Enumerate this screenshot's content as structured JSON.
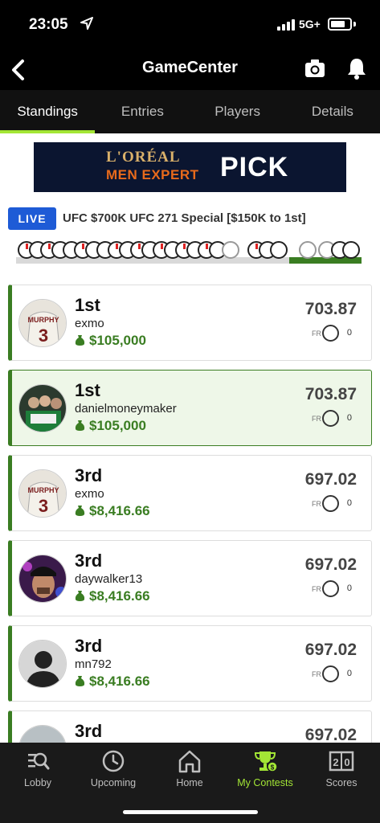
{
  "status_bar": {
    "time": "23:05",
    "network": "5G+"
  },
  "header": {
    "title": "GameCenter",
    "icons": [
      "back-icon",
      "camera-icon",
      "bell-icon"
    ]
  },
  "tabs": [
    {
      "label": "Standings",
      "active": true
    },
    {
      "label": "Entries",
      "active": false
    },
    {
      "label": "Players",
      "active": false
    },
    {
      "label": "Details",
      "active": false
    }
  ],
  "ad": {
    "brand_line1": "L'ORÉAL",
    "brand_line2": "MEN EXPERT",
    "cta": "PICK"
  },
  "contest": {
    "live_label": "LIVE",
    "title": "UFC $700K UFC 271 Special [$150K to 1st]"
  },
  "entries": [
    {
      "rank": "1st",
      "username": "exmo",
      "prize": "$105,000",
      "score": "703.87",
      "fr_label": "FR",
      "fr_count": "0",
      "highlighted": false
    },
    {
      "rank": "1st",
      "username": "danielmoneymaker",
      "prize": "$105,000",
      "score": "703.87",
      "fr_label": "FR",
      "fr_count": "0",
      "highlighted": true
    },
    {
      "rank": "3rd",
      "username": "exmo",
      "prize": "$8,416.66",
      "score": "697.02",
      "fr_label": "FR",
      "fr_count": "0",
      "highlighted": false
    },
    {
      "rank": "3rd",
      "username": "daywalker13",
      "prize": "$8,416.66",
      "score": "697.02",
      "fr_label": "FR",
      "fr_count": "0",
      "highlighted": false
    },
    {
      "rank": "3rd",
      "username": "mn792",
      "prize": "$8,416.66",
      "score": "697.02",
      "fr_label": "FR",
      "fr_count": "0",
      "highlighted": false
    },
    {
      "rank": "3rd",
      "username": "",
      "prize": "",
      "score": "697.02",
      "fr_label": "",
      "fr_count": "",
      "highlighted": false
    }
  ],
  "bottom_nav": [
    {
      "label": "Lobby",
      "icon": "lobby-search-icon",
      "active": false
    },
    {
      "label": "Upcoming",
      "icon": "clock-icon",
      "active": false
    },
    {
      "label": "Home",
      "icon": "home-icon",
      "active": false
    },
    {
      "label": "My Contests",
      "icon": "trophy-icon",
      "active": true
    },
    {
      "label": "Scores",
      "icon": "scoreboard-icon",
      "active": false
    }
  ],
  "colors": {
    "accent": "#a3e635",
    "money_green": "#3a7d22",
    "live_blue": "#1e5bd6"
  }
}
